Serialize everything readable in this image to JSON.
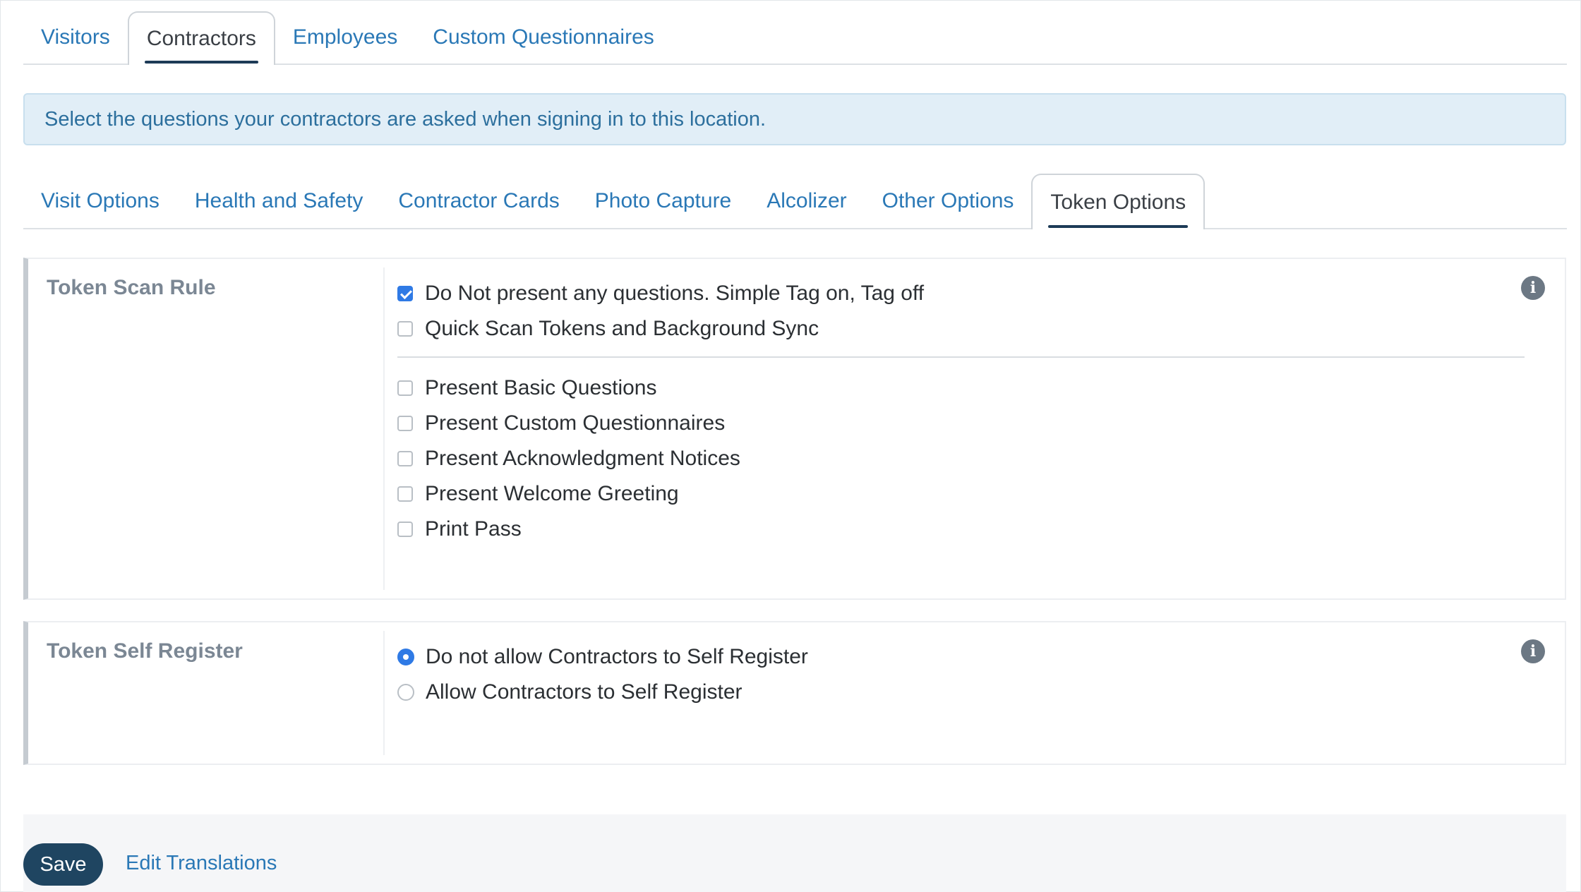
{
  "tabs_top": [
    {
      "label": "Visitors",
      "active": false
    },
    {
      "label": "Contractors",
      "active": true
    },
    {
      "label": "Employees",
      "active": false
    },
    {
      "label": "Custom Questionnaires",
      "active": false
    }
  ],
  "alert_text": "Select the questions your contractors are asked when signing in to this location.",
  "tabs_sub": [
    {
      "label": "Visit Options",
      "active": false
    },
    {
      "label": "Health and Safety",
      "active": false
    },
    {
      "label": "Contractor Cards",
      "active": false
    },
    {
      "label": "Photo Capture",
      "active": false
    },
    {
      "label": "Alcolizer",
      "active": false
    },
    {
      "label": "Other Options",
      "active": false
    },
    {
      "label": "Token Options",
      "active": true
    }
  ],
  "token_scan_rule": {
    "label": "Token Scan Rule",
    "options_primary": [
      {
        "label": "Do Not present any questions. Simple Tag on, Tag off",
        "checked": true
      },
      {
        "label": "Quick Scan Tokens and Background Sync",
        "checked": false
      }
    ],
    "options_secondary": [
      {
        "label": "Present Basic Questions",
        "checked": false
      },
      {
        "label": "Present Custom Questionnaires",
        "checked": false
      },
      {
        "label": "Present Acknowledgment Notices",
        "checked": false
      },
      {
        "label": "Present Welcome Greeting",
        "checked": false
      },
      {
        "label": "Print Pass",
        "checked": false
      }
    ],
    "info_icon": "i"
  },
  "token_self_register": {
    "label": "Token Self Register",
    "options": [
      {
        "label": "Do not allow Contractors to Self Register",
        "selected": true
      },
      {
        "label": "Allow Contractors to Self Register",
        "selected": false
      }
    ],
    "info_icon": "i"
  },
  "footer": {
    "save_label": "Save",
    "edit_translations_label": "Edit Translations"
  },
  "colors": {
    "link": "#2a78b6",
    "accent_checked": "#2f7ae5",
    "save_button": "#1f4561",
    "alert_bg": "#e1eef7"
  }
}
